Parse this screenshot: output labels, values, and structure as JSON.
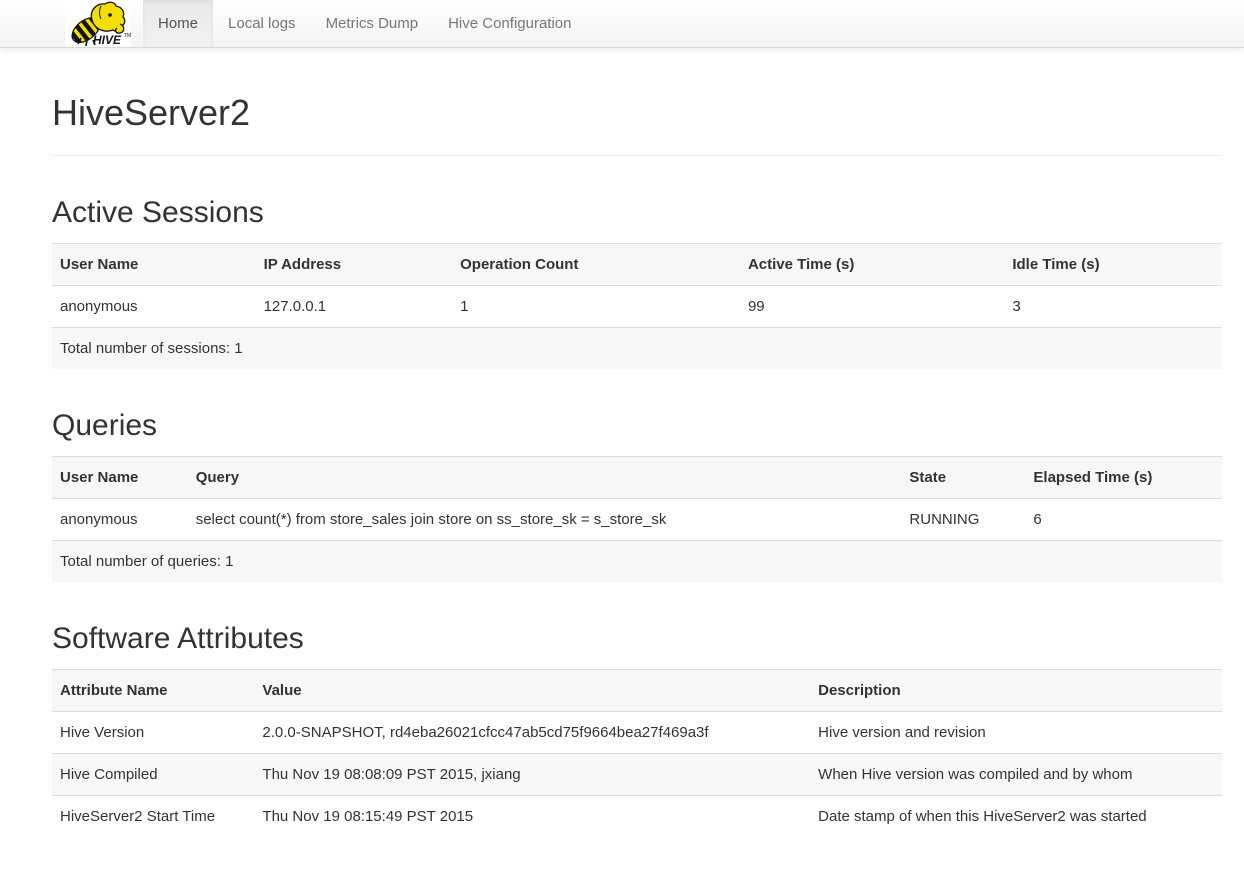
{
  "navbar": {
    "logo": "hive-bee-logo",
    "logo_text": "HIVE",
    "logo_tm": "TM",
    "items": [
      {
        "label": "Home",
        "active": true
      },
      {
        "label": "Local logs",
        "active": false
      },
      {
        "label": "Metrics Dump",
        "active": false
      },
      {
        "label": "Hive Configuration",
        "active": false
      }
    ]
  },
  "page_title": "HiveServer2",
  "sections": {
    "active_sessions": {
      "title": "Active Sessions",
      "columns": [
        "User Name",
        "IP Address",
        "Operation Count",
        "Active Time (s)",
        "Idle Time (s)"
      ],
      "rows": [
        [
          "anonymous",
          "127.0.0.1",
          "1",
          "99",
          "3"
        ]
      ],
      "footer": "Total number of sessions: 1"
    },
    "queries": {
      "title": "Queries",
      "columns": [
        "User Name",
        "Query",
        "State",
        "Elapsed Time (s)"
      ],
      "rows": [
        [
          "anonymous",
          "select count(*) from store_sales join store on ss_store_sk = s_store_sk",
          "RUNNING",
          "6"
        ]
      ],
      "footer": "Total number of queries: 1"
    },
    "software_attributes": {
      "title": "Software Attributes",
      "columns": [
        "Attribute Name",
        "Value",
        "Description"
      ],
      "rows": [
        [
          "Hive Version",
          "2.0.0-SNAPSHOT, rd4eba26021cfcc47ab5cd75f9664bea27f469a3f",
          "Hive version and revision"
        ],
        [
          "Hive Compiled",
          "Thu Nov 19 08:08:09 PST 2015, jxiang",
          "When Hive version was compiled and by whom"
        ],
        [
          "HiveServer2 Start Time",
          "Thu Nov 19 08:15:49 PST 2015",
          "Date stamp of when this HiveServer2 was started"
        ]
      ],
      "footer": null
    }
  },
  "colors": {
    "navbar_bg": "#f8f8f8",
    "navbar_border": "#d9d9d9",
    "nav_link": "#777777",
    "nav_link_active": "#555555",
    "nav_active_bg": "#e9e9e9",
    "text": "#333333",
    "table_border": "#dddddd",
    "table_stripe": "#f7f7f7",
    "header_rule": "#eeeeee",
    "logo_yellow": "#f2de00",
    "logo_black": "#141414"
  }
}
